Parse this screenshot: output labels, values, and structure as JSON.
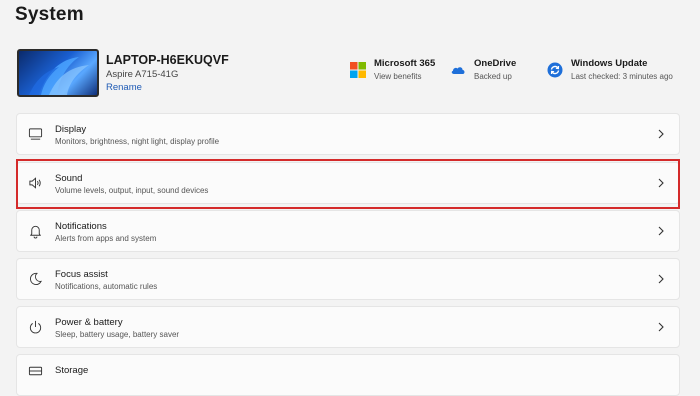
{
  "page": {
    "title": "System"
  },
  "device": {
    "name": "LAPTOP-H6EKUQVF",
    "model": "Aspire A715-41G",
    "rename_label": "Rename"
  },
  "services": [
    {
      "title": "Microsoft 365",
      "subtitle": "View benefits",
      "icon": "microsoft-logo-icon"
    },
    {
      "title": "OneDrive",
      "subtitle": "Backed up",
      "icon": "cloud-icon"
    },
    {
      "title": "Windows Update",
      "subtitle": "Last checked: 3 minutes ago",
      "icon": "update-icon"
    }
  ],
  "settings": [
    {
      "title": "Display",
      "subtitle": "Monitors, brightness, night light, display profile",
      "icon": "monitor-icon"
    },
    {
      "title": "Sound",
      "subtitle": "Volume levels, output, input, sound devices",
      "icon": "speaker-icon",
      "highlighted": true
    },
    {
      "title": "Notifications",
      "subtitle": "Alerts from apps and system",
      "icon": "bell-icon"
    },
    {
      "title": "Focus assist",
      "subtitle": "Notifications, automatic rules",
      "icon": "moon-icon"
    },
    {
      "title": "Power & battery",
      "subtitle": "Sleep, battery usage, battery saver",
      "icon": "power-icon"
    },
    {
      "title": "Storage",
      "subtitle": "",
      "icon": "storage-icon"
    }
  ],
  "colors": {
    "background": "#f3f3f3",
    "card": "#fbfbfb",
    "link": "#1f5bb5",
    "highlight": "#d42a2a"
  }
}
